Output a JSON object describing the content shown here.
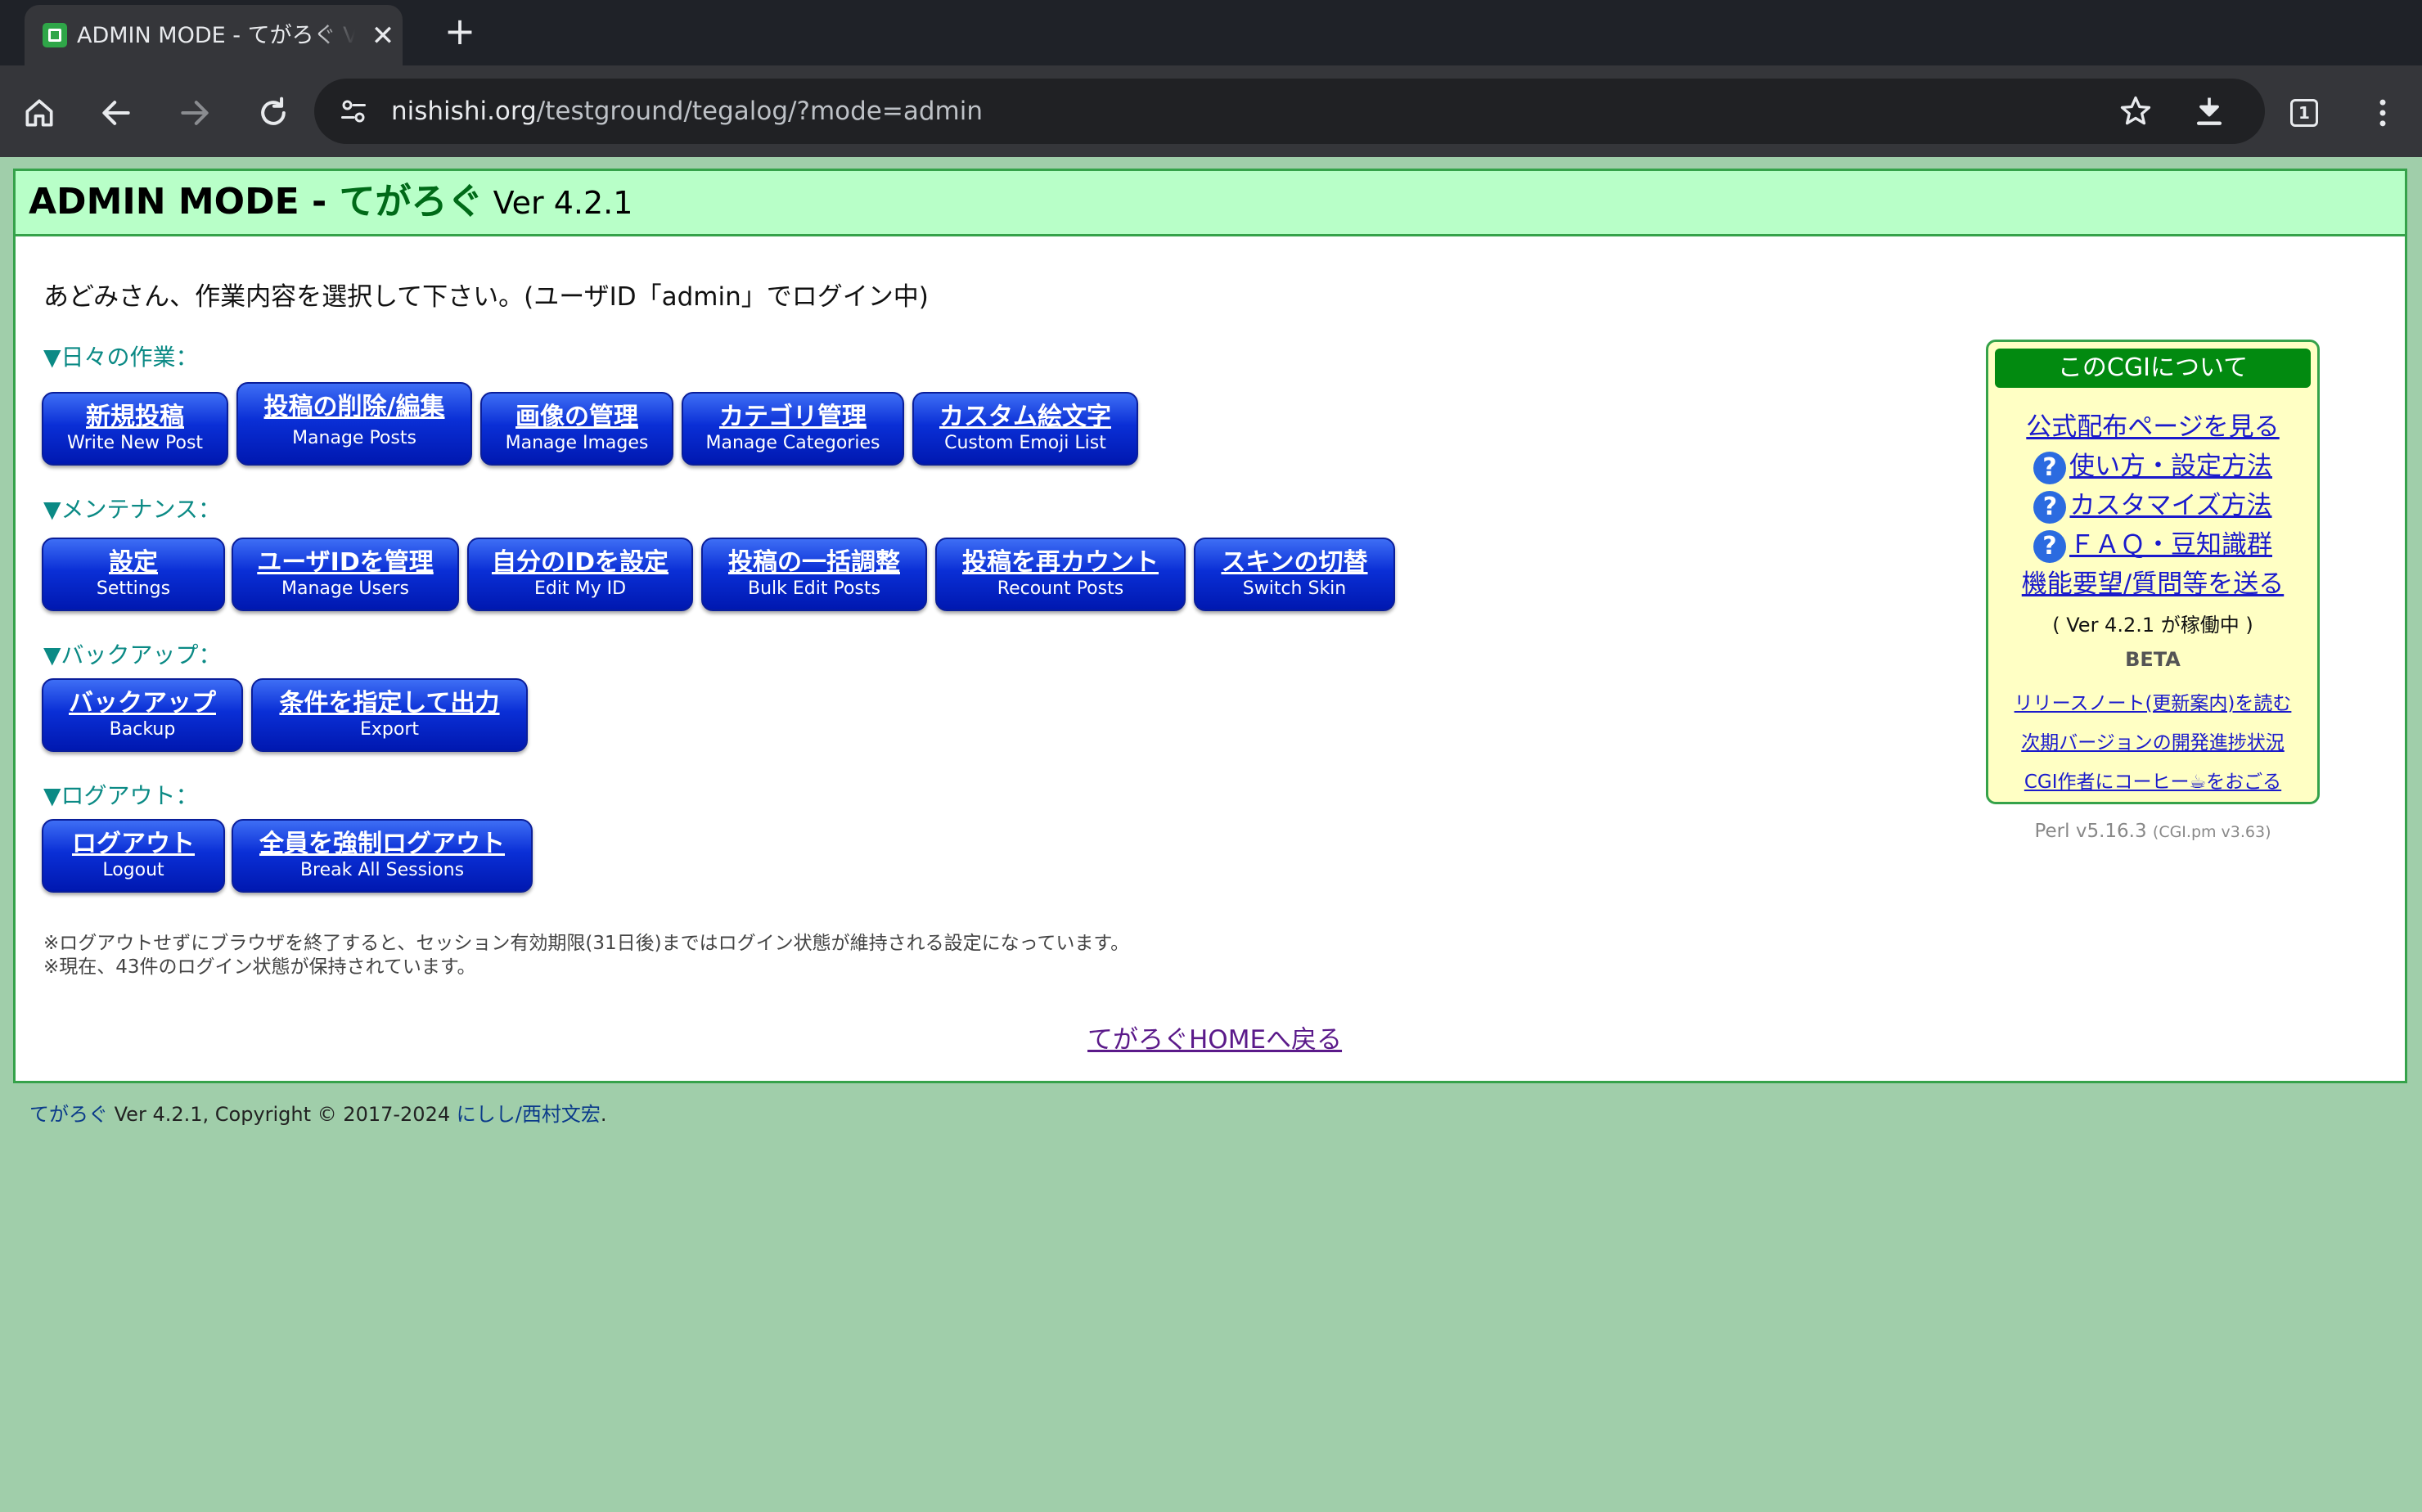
{
  "browser": {
    "tab_title": "ADMIN MODE - てがろぐ Ver 4.2.1",
    "url_host": "nishishi.org",
    "url_path": "/testground/tegalog/?mode=admin",
    "tab_count": "1",
    "icons": [
      "home-icon",
      "back-icon",
      "forward-icon",
      "reload-icon",
      "tune-icon",
      "star-icon",
      "download-icon",
      "tab-switcher-icon",
      "menu-icon",
      "close-icon",
      "plus-icon"
    ]
  },
  "header": {
    "title": "ADMIN MODE - ",
    "app_name": "てがろぐ",
    "version": " Ver 4.2.1"
  },
  "greeting": "あどみさん、作業内容を選択して下さい。(ユーザID「admin」でログイン中)",
  "sections": {
    "daily": "▼日々の作業：",
    "maintenance": "▼メンテナンス：",
    "backup": "▼バックアップ：",
    "logout": "▼ログアウト："
  },
  "buttons": {
    "new_post": {
      "jp": "新規投稿",
      "en": "Write New Post"
    },
    "manage_posts": {
      "jp": "投稿の削除/編集",
      "en": "Manage Posts"
    },
    "manage_images": {
      "jp": "画像の管理",
      "en": "Manage Images"
    },
    "categories": {
      "jp": "カテゴリ管理",
      "en": "Manage Categories"
    },
    "emoji": {
      "jp": "カスタム絵文字",
      "en": "Custom Emoji List"
    },
    "settings": {
      "jp": "設定",
      "en": "Settings"
    },
    "users": {
      "jp": "ユーザIDを管理",
      "en": "Manage Users"
    },
    "my_id": {
      "jp": "自分のIDを設定",
      "en": "Edit My ID"
    },
    "bulk_edit": {
      "jp": "投稿の一括調整",
      "en": "Bulk Edit Posts"
    },
    "recount": {
      "jp": "投稿を再カウント",
      "en": "Recount Posts"
    },
    "skin": {
      "jp": "スキンの切替",
      "en": "Switch Skin"
    },
    "backup": {
      "jp": "バックアップ",
      "en": "Backup"
    },
    "export": {
      "jp": "条件を指定して出力",
      "en": "Export"
    },
    "logout": {
      "jp": "ログアウト",
      "en": "Logout"
    },
    "force_logout": {
      "jp": "全員を強制ログアウト",
      "en": "Break All Sessions"
    }
  },
  "notes": [
    "※ログアウトせずにブラウザを終了すると、セッション有効期限(31日後)まではログイン状態が維持される設定になっています。",
    "※現在、43件のログイン状態が保持されています。"
  ],
  "home_link": "てがろぐHOMEへ戻る",
  "about": {
    "title": "このCGIについて",
    "official": "公式配布ページを見る",
    "howto": "使い方・設定方法",
    "customize": "カスタマイズ方法",
    "faq": "ＦＡＱ・豆知識群",
    "request": "機能要望/質問等を送る",
    "running": "( Ver 4.2.1 が稼働中 )",
    "beta": "BETA",
    "release_notes": "リリースノート(更新案内)を読む",
    "next_version": "次期バージョンの開発進捗状況",
    "coffee": "CGI作者にコーヒー☕をおごる",
    "q_mark": "?"
  },
  "perl": {
    "version": "Perl v5.16.3",
    "cgi": "(CGI.pm v3.63)"
  },
  "footer": {
    "app": "てがろぐ",
    "text": " Ver 4.2.1, Copyright © 2017-2024 ",
    "author": "にしし/西村文宏",
    "dot": "."
  }
}
